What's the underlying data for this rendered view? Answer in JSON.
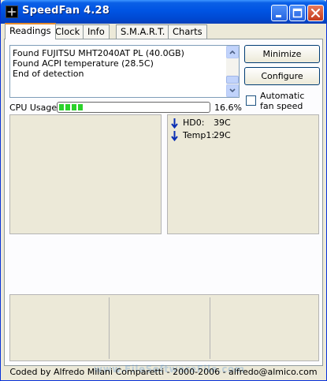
{
  "window": {
    "title": "SpeedFan 4.28"
  },
  "tabs": [
    "Readings",
    "Clock",
    "Info",
    "S.M.A.R.T.",
    "Charts"
  ],
  "log": {
    "lines": [
      "Found FUJITSU MHT2040AT PL (40.0GB)",
      "Found ACPI temperature (28.5C)",
      "End of detection"
    ]
  },
  "buttons": {
    "minimize": "Minimize",
    "configure": "Configure"
  },
  "auto_fan": {
    "label": "Automatic fan speed",
    "checked": false
  },
  "cpu": {
    "label": "CPU Usage",
    "value": "16.6%",
    "fraction": 0.166
  },
  "temperatures": [
    {
      "name": "HD0:",
      "value": "39C",
      "trend": "down",
      "icon": "arrow-down-icon"
    },
    {
      "name": "Temp1:",
      "value": "29C",
      "trend": "down",
      "icon": "arrow-down-icon"
    }
  ],
  "footer": {
    "credits": "Coded by Alfredo Milani Comparetti - 2000-2006 - alfredo@almico.com",
    "watermark": "www.FileSoftwareFile.com"
  },
  "colors": {
    "titlebar": "#0054e3",
    "cpu_bar": "#2bd22b",
    "trend_arrow": "#0a2fb4",
    "active_tab_accent": "#e68b2c"
  }
}
